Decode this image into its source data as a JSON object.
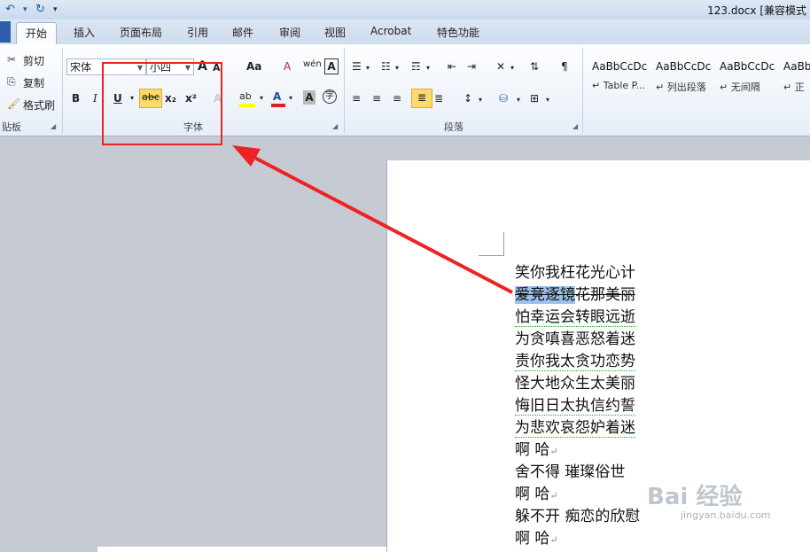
{
  "title_bar": {
    "doc_title": "123.docx [兼容模式",
    "undo_icon": "undo-icon",
    "redo_icon": "redo-icon",
    "customize_icon": "customize-qat-icon"
  },
  "tabs": [
    "开始",
    "插入",
    "页面布局",
    "引用",
    "邮件",
    "审阅",
    "视图",
    "Acrobat",
    "特色功能"
  ],
  "active_tab": "开始",
  "clipboard": {
    "group_label": "贴板",
    "cut": "剪切",
    "copy": "复制",
    "format_painter": "格式刷"
  },
  "font": {
    "group_label": "字体",
    "font_name": "宋体",
    "font_size": "小四",
    "grow": "A",
    "shrink": "A",
    "change_case": "Aa",
    "clear_format": "A",
    "pinyin": "wén",
    "border_char": "A",
    "bold": "B",
    "italic": "I",
    "underline": "U",
    "strikethrough": "abc",
    "subscript": "x₂",
    "superscript": "x²",
    "text_effect": "A",
    "highlight": "ab",
    "font_color": "A",
    "char_shading": "A",
    "enclose": "字"
  },
  "paragraph": {
    "group_label": "段落"
  },
  "styles": [
    {
      "sample": "AaBbCcDc",
      "name": "Table P..."
    },
    {
      "sample": "AaBbCcDc",
      "name": "列出段落"
    },
    {
      "sample": "AaBbCcDc",
      "name": "无间隔"
    },
    {
      "sample": "AaBb",
      "name": "正"
    }
  ],
  "document_lines": [
    {
      "text": "笑你我枉花光心计"
    },
    {
      "highlight": "爱竞逐镜",
      "text": "花那美丽"
    },
    {
      "text": "怕幸运会转眼远逝"
    },
    {
      "text": "为贪嗔喜恶怒着迷"
    },
    {
      "text": "责你我太贪功恋势"
    },
    {
      "text": "怪大地众生太美丽"
    },
    {
      "text": "悔旧日太执信约誓"
    },
    {
      "text": "为悲欢哀怨妒着迷"
    },
    {
      "text": "啊  哈",
      "mark": "↵"
    },
    {
      "text": "舍不得  璀璨俗世"
    },
    {
      "text": "啊  哈",
      "mark": "↵"
    },
    {
      "text": "躲不开  痴恋的欣慰"
    },
    {
      "text": "啊  哈",
      "mark": "↵"
    }
  ],
  "watermark": {
    "text": "Bai 经验",
    "sub": "jingyan.baidu.com"
  },
  "colors": {
    "annotation": "#ee2222",
    "selection": "#9cc2ec",
    "font_color_bar": "#e02020",
    "highlight_bar": "#ffff00"
  }
}
